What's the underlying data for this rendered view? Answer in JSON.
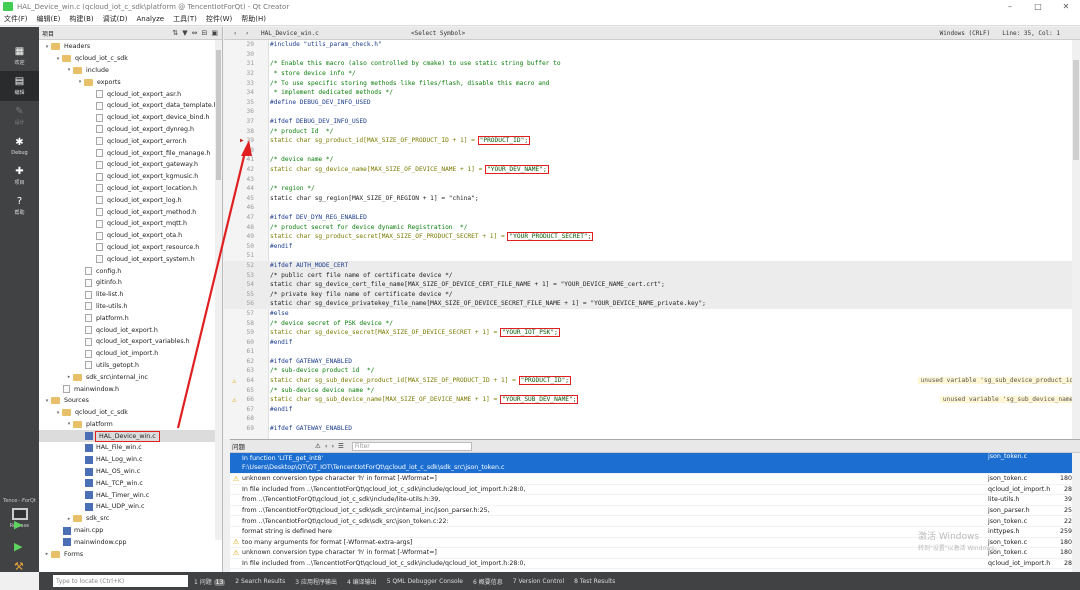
{
  "window": {
    "title": "HAL_Device_win.c (qcloud_iot_c_sdk\\platform @ TencentIotForQt) - Qt Creator",
    "controls": [
      "–",
      "□",
      "✕"
    ]
  },
  "menu": [
    "文件(F)",
    "编辑(E)",
    "构建(B)",
    "调试(D)",
    "Analyze",
    "工具(T)",
    "控件(W)",
    "帮助(H)"
  ],
  "modes": [
    {
      "label": "欢迎",
      "icon": "grid"
    },
    {
      "label": "编辑",
      "icon": "edit"
    },
    {
      "label": "设计",
      "icon": "pen"
    },
    {
      "label": "Debug",
      "icon": "bug"
    },
    {
      "label": "项目",
      "icon": "wrench"
    },
    {
      "label": "帮助",
      "icon": "help"
    }
  ],
  "kit": {
    "name": "Tence···ForQt",
    "config": "Release"
  },
  "project": {
    "toolbar_label": "项目",
    "nodes": [
      {
        "label": "Headers",
        "type": "folder",
        "depth": 1,
        "expanded": true
      },
      {
        "label": "qcloud_iot_c_sdk",
        "type": "folder",
        "depth": 2,
        "expanded": true
      },
      {
        "label": "include",
        "type": "folder",
        "depth": 3,
        "expanded": true
      },
      {
        "label": "exports",
        "type": "folder",
        "depth": 4,
        "expanded": true
      },
      {
        "label": "qcloud_iot_export_asr.h",
        "type": "file",
        "depth": 5
      },
      {
        "label": "qcloud_iot_export_data_template.h",
        "type": "file",
        "depth": 5
      },
      {
        "label": "qcloud_iot_export_device_bind.h",
        "type": "file",
        "depth": 5
      },
      {
        "label": "qcloud_iot_export_dynreg.h",
        "type": "file",
        "depth": 5
      },
      {
        "label": "qcloud_iot_export_error.h",
        "type": "file",
        "depth": 5
      },
      {
        "label": "qcloud_iot_export_file_manage.h",
        "type": "file",
        "depth": 5
      },
      {
        "label": "qcloud_iot_export_gateway.h",
        "type": "file",
        "depth": 5
      },
      {
        "label": "qcloud_iot_export_kgmusic.h",
        "type": "file",
        "depth": 5
      },
      {
        "label": "qcloud_iot_export_location.h",
        "type": "file",
        "depth": 5
      },
      {
        "label": "qcloud_iot_export_log.h",
        "type": "file",
        "depth": 5
      },
      {
        "label": "qcloud_iot_export_method.h",
        "type": "file",
        "depth": 5
      },
      {
        "label": "qcloud_iot_export_mqtt.h",
        "type": "file",
        "depth": 5
      },
      {
        "label": "qcloud_iot_export_ota.h",
        "type": "file",
        "depth": 5
      },
      {
        "label": "qcloud_iot_export_resource.h",
        "type": "file",
        "depth": 5
      },
      {
        "label": "qcloud_iot_export_system.h",
        "type": "file",
        "depth": 5
      },
      {
        "label": "config.h",
        "type": "file",
        "depth": 4
      },
      {
        "label": "gitinfo.h",
        "type": "file",
        "depth": 4
      },
      {
        "label": "lite-list.h",
        "type": "file",
        "depth": 4
      },
      {
        "label": "lite-utils.h",
        "type": "file",
        "depth": 4
      },
      {
        "label": "platform.h",
        "type": "file",
        "depth": 4
      },
      {
        "label": "qcloud_iot_export.h",
        "type": "file",
        "depth": 4
      },
      {
        "label": "qcloud_iot_export_variables.h",
        "type": "file",
        "depth": 4
      },
      {
        "label": "qcloud_iot_import.h",
        "type": "file",
        "depth": 4
      },
      {
        "label": "utils_getopt.h",
        "type": "file",
        "depth": 4
      },
      {
        "label": "sdk_src\\internal_inc",
        "type": "folder",
        "depth": 3,
        "expanded": false
      },
      {
        "label": "mainwindow.h",
        "type": "file",
        "depth": 2
      },
      {
        "label": "Sources",
        "type": "folder",
        "depth": 1,
        "expanded": true
      },
      {
        "label": "qcloud_iot_c_sdk",
        "type": "folder",
        "depth": 2,
        "expanded": true
      },
      {
        "label": "platform",
        "type": "folder",
        "depth": 3,
        "expanded": true
      },
      {
        "label": "HAL_Device_win.c",
        "type": "cfile",
        "depth": 4,
        "selected": true
      },
      {
        "label": "HAL_File_win.c",
        "type": "cfile",
        "depth": 4
      },
      {
        "label": "HAL_Log_win.c",
        "type": "cfile",
        "depth": 4
      },
      {
        "label": "HAL_OS_win.c",
        "type": "cfile",
        "depth": 4
      },
      {
        "label": "HAL_TCP_win.c",
        "type": "cfile",
        "depth": 4
      },
      {
        "label": "HAL_Timer_win.c",
        "type": "cfile",
        "depth": 4
      },
      {
        "label": "HAL_UDP_win.c",
        "type": "cfile",
        "depth": 4
      },
      {
        "label": "sdk_src",
        "type": "folder",
        "depth": 3,
        "expanded": false
      },
      {
        "label": "main.cpp",
        "type": "cfile",
        "depth": 2
      },
      {
        "label": "mainwindow.cpp",
        "type": "cfile",
        "depth": 2
      },
      {
        "label": "Forms",
        "type": "folder",
        "depth": 1,
        "expanded": false
      }
    ]
  },
  "editor": {
    "file": "HAL_Device_win.c",
    "symbol": "<Select Symbol>",
    "encoding": "Windows (CRLF)",
    "position": "Line: 35, Col: 1",
    "lines": [
      {
        "n": "29",
        "t": "#include \"utils_param_check.h\"",
        "k": "pp"
      },
      {
        "n": "30",
        "t": "",
        "k": ""
      },
      {
        "n": "31",
        "t": "/* Enable this macro (also controlled by cmake) to use static string buffer to",
        "k": "cm"
      },
      {
        "n": "32",
        "t": " * store device info */",
        "k": "cm"
      },
      {
        "n": "33",
        "t": "/* To use specific storing methods like files/flash, disable this macro and",
        "k": "cm"
      },
      {
        "n": "34",
        "t": " * implement dedicated methods */",
        "k": "cm"
      },
      {
        "n": "35",
        "t": "#define DEBUG_DEV_INFO_USED",
        "k": "pp"
      },
      {
        "n": "36",
        "t": "",
        "k": ""
      },
      {
        "n": "37",
        "t": "#ifdef DEBUG_DEV_INFO_USED",
        "k": "pp"
      },
      {
        "n": "38",
        "t": "/* product Id  */",
        "k": "cm"
      },
      {
        "n": "39",
        "t": "static char sg_product_id[MAX_SIZE_OF_PRODUCT_ID + 1] = ",
        "s": "\"PRODUCT_ID\";",
        "k": "code",
        "bp": true
      },
      {
        "n": "40",
        "t": "",
        "k": ""
      },
      {
        "n": "41",
        "t": "/* device name */",
        "k": "cm"
      },
      {
        "n": "42",
        "t": "static char sg_device_name[MAX_SIZE_OF_DEVICE_NAME + 1] = ",
        "s": "\"YOUR_DEV_NAME\";",
        "k": "code"
      },
      {
        "n": "43",
        "t": "",
        "k": ""
      },
      {
        "n": "44",
        "t": "/* region */",
        "k": "cm"
      },
      {
        "n": "45",
        "t": "static char sg_region[MAX_SIZE_OF_REGION + 1] = \"china\";",
        "k": "plain"
      },
      {
        "n": "46",
        "t": "",
        "k": ""
      },
      {
        "n": "47",
        "t": "#ifdef DEV_DYN_REG_ENABLED",
        "k": "pp"
      },
      {
        "n": "48",
        "t": "/* product secret for device dynamic Registration  */",
        "k": "cm"
      },
      {
        "n": "49",
        "t": "static char sg_product_secret[MAX_SIZE_OF_PRODUCT_SECRET + 1] = ",
        "s": "\"YOUR_PRODUCT_SECRET\";",
        "k": "code"
      },
      {
        "n": "50",
        "t": "#endif",
        "k": "pp"
      },
      {
        "n": "51",
        "t": "",
        "k": ""
      },
      {
        "n": "52",
        "t": "#ifdef AUTH_MODE_CERT",
        "k": "pp",
        "g": true
      },
      {
        "n": "53",
        "t": "/* public cert file name of certificate device */",
        "k": "plain",
        "g": true
      },
      {
        "n": "54",
        "t": "static char sg_device_cert_file_name[MAX_SIZE_OF_DEVICE_CERT_FILE_NAME + 1] = \"YOUR_DEVICE_NAME_cert.crt\";",
        "k": "plain",
        "g": true
      },
      {
        "n": "55",
        "t": "/* private key file name of certificate device */",
        "k": "plain",
        "g": true
      },
      {
        "n": "56",
        "t": "static char sg_device_privatekey_file_name[MAX_SIZE_OF_DEVICE_SECRET_FILE_NAME + 1] = \"YOUR_DEVICE_NAME_private.key\";",
        "k": "plain",
        "g": true
      },
      {
        "n": "57",
        "t": "#else",
        "k": "pp"
      },
      {
        "n": "58",
        "t": "/* device secret of PSK device */",
        "k": "cm"
      },
      {
        "n": "59",
        "t": "static char sg_device_secret[MAX_SIZE_OF_DEVICE_SECRET + 1] = ",
        "s": "\"YOUR_IOT_PSK\";",
        "k": "code"
      },
      {
        "n": "60",
        "t": "#endif",
        "k": "pp"
      },
      {
        "n": "61",
        "t": "",
        "k": ""
      },
      {
        "n": "62",
        "t": "#ifdef GATEWAY_ENABLED",
        "k": "pp"
      },
      {
        "n": "63",
        "t": "/* sub-device product id  */",
        "k": "cm"
      },
      {
        "n": "64",
        "t": "static char sg_sub_device_product_id[MAX_SIZE_OF_PRODUCT_ID + 1] = ",
        "s": "\"PRODUCT_ID\";",
        "k": "code",
        "w": "unused variable 'sg_sub_device_product_id'"
      },
      {
        "n": "65",
        "t": "/* sub-device device name */",
        "k": "cm"
      },
      {
        "n": "66",
        "t": "static char sg_sub_device_name[MAX_SIZE_OF_DEVICE_NAME + 1] = ",
        "s": "\"YOUR_SUB_DEV_NAME\";",
        "k": "code",
        "w": "unused variable 'sg_sub_device_name'"
      },
      {
        "n": "67",
        "t": "#endif",
        "k": "pp"
      },
      {
        "n": "68",
        "t": "",
        "k": ""
      },
      {
        "n": "69",
        "t": "#ifdef GATEWAY_ENABLED",
        "k": "pp"
      }
    ]
  },
  "issues": {
    "title": "问题",
    "filter_placeholder": "Filter",
    "rows": [
      {
        "msg": "In function 'LITE_get_int8'",
        "msg2": "F:\\Users\\Desktop\\QT\\QT_IOT\\TencentIotForQt\\qcloud_iot_c_sdk\\sdk_src\\json_token.c",
        "file": "json_token.c",
        "line": "",
        "sel": true
      },
      {
        "msg": "unknown conversion type character 'h' in format [-Wformat=]",
        "file": "json_token.c",
        "line": "180",
        "warn": true
      },
      {
        "msg": "In file included from ..\\TencentIotForQt\\qcloud_iot_c_sdk\\include/qcloud_iot_import.h:28:0,",
        "file": "qcloud_iot_import.h",
        "line": "28"
      },
      {
        "msg": "from ..\\TencentIotForQt\\qcloud_iot_c_sdk\\include/lite-utils.h:39,",
        "file": "lite-utils.h",
        "line": "39"
      },
      {
        "msg": "from ..\\TencentIotForQt\\qcloud_iot_c_sdk\\sdk_src\\internal_inc/json_parser.h:25,",
        "file": "json_parser.h",
        "line": "25"
      },
      {
        "msg": "from ..\\TencentIotForQt\\qcloud_iot_c_sdk\\sdk_src\\json_token.c:22:",
        "file": "json_token.c",
        "line": "22"
      },
      {
        "msg": "format string is defined here",
        "file": "inttypes.h",
        "line": "259"
      },
      {
        "msg": "too many arguments for format [-Wformat-extra-args]",
        "file": "json_token.c",
        "line": "180",
        "warn": true
      },
      {
        "msg": "unknown conversion type character 'h' in format [-Wformat=]",
        "file": "json_token.c",
        "line": "180",
        "warn": true
      },
      {
        "msg": "In file included from ..\\TencentIotForQt\\qcloud_iot_c_sdk\\include/qcloud_iot_import.h:28:0,",
        "file": "qcloud_iot_import.h",
        "line": "28"
      }
    ]
  },
  "bottom": {
    "locate_placeholder": "Type to locate (Ctrl+K)",
    "issue_count": "13",
    "tabs": [
      "1 问题",
      "2 Search Results",
      "3 应用程序输出",
      "4 编译输出",
      "5 QML Debugger Console",
      "6 概要信息",
      "7 Version Control",
      "8 Test Results"
    ]
  },
  "watermark": {
    "line1": "激活 Windows",
    "line2": "转到\"设置\"以激活 Windows。"
  }
}
